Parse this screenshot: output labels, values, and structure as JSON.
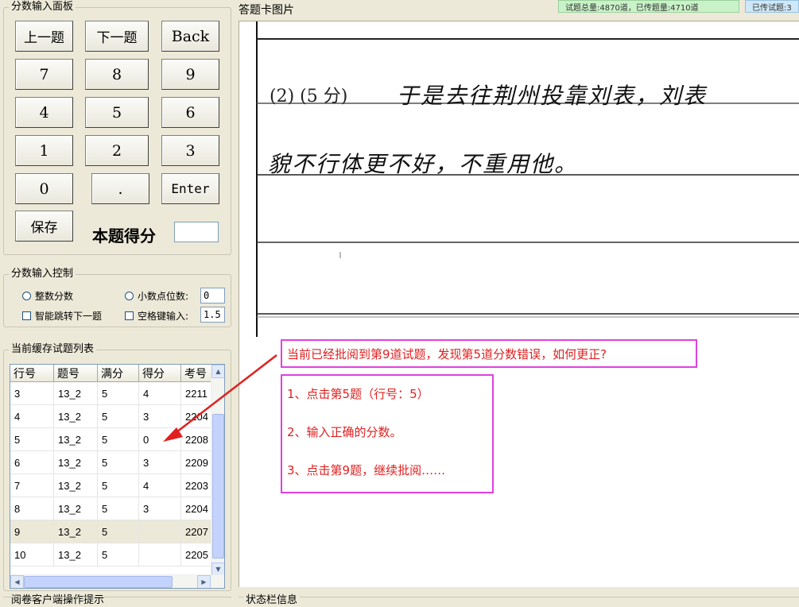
{
  "score_panel": {
    "title": "分数输入面板",
    "buttons": {
      "prev": "上一题",
      "next": "下一题",
      "back": "Back",
      "k7": "7",
      "k8": "8",
      "k9": "9",
      "k4": "4",
      "k5": "5",
      "k6": "6",
      "k1": "1",
      "k2": "2",
      "k3": "3",
      "k0": "0",
      "dot": ".",
      "enter": "Enter",
      "save": "保存"
    },
    "score_label": "本题得分",
    "score_value": ""
  },
  "control_panel": {
    "title": "分数输入控制",
    "integer_label": "整数分数",
    "decimal_label": "小数点位数:",
    "decimal_value": "0",
    "smart_jump_label": "智能跳转下一题",
    "space_input_label": "空格键输入:",
    "space_input_value": "1.5"
  },
  "cache_list": {
    "title": "当前缓存试题列表",
    "columns": [
      "行号",
      "题号",
      "满分",
      "得分",
      "考号"
    ],
    "rows": [
      [
        "3",
        "13_2",
        "5",
        "4",
        "2211"
      ],
      [
        "4",
        "13_2",
        "5",
        "3",
        "2204"
      ],
      [
        "5",
        "13_2",
        "5",
        "0",
        "2208"
      ],
      [
        "6",
        "13_2",
        "5",
        "3",
        "2209"
      ],
      [
        "7",
        "13_2",
        "5",
        "4",
        "2203"
      ],
      [
        "8",
        "13_2",
        "5",
        "3",
        "2204"
      ],
      [
        "9",
        "13_2",
        "5",
        "",
        "2207"
      ],
      [
        "10",
        "13_2",
        "5",
        "",
        "2205"
      ]
    ],
    "selected_row": "9"
  },
  "client_hint_title": "阅卷客户端操作提示",
  "answer_card": {
    "title": "答题卡图片",
    "line1_print": "(2) (5 分)",
    "line1_hand": "于是去往荆州投靠刘表，刘表",
    "line2_hand": "貌不行体更不好，不重用他。"
  },
  "status_bar_title": "状态栏信息",
  "top_status": {
    "box1": "试题总量:4870道，已传题量:4710道",
    "box2": "已传试题:3"
  },
  "annotation": {
    "question": "当前已经批阅到第9道试题，发现第5道分数错误，如何更正?",
    "steps": [
      "1、点击第5题（行号：5）",
      "2、输入正确的分数。",
      "3、点击第9题，继续批阅……"
    ]
  },
  "colors": {
    "annotation_border": "#e040e0",
    "annotation_text": "#e02020",
    "arrow": "#e02020"
  }
}
